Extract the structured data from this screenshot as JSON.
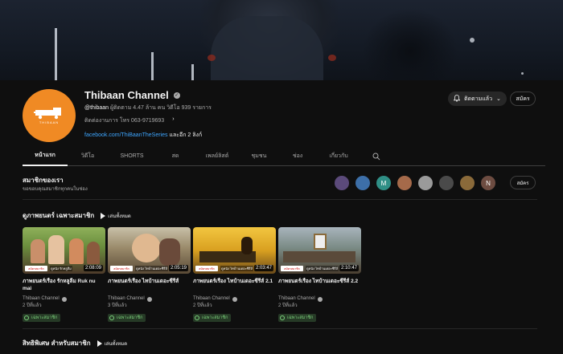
{
  "channel": {
    "name": "Thibaan Channel",
    "handle": "@thibaan",
    "subscribers": "ผู้ติดตาม 4.47 ล้าน คน",
    "videos": "วิดีโอ 939 รายการ",
    "contact": "ติดต่องานการ โทร 063-9719693",
    "link": "facebook.com/ThiBaanTheSeries",
    "link_more": "และอีก 2 ลิงก์",
    "avatar_text": "THIBAAN",
    "accent": "#f08a24"
  },
  "actions": {
    "subscribed_label": "ติดตามแล้ว",
    "join_label": "สมัคร"
  },
  "tabs": [
    {
      "label": "หน้าแรก",
      "active": true
    },
    {
      "label": "วิดีโอ"
    },
    {
      "label": "SHORTS"
    },
    {
      "label": "สด"
    },
    {
      "label": "เพลย์ลิสต์"
    },
    {
      "label": "ชุมชน"
    },
    {
      "label": "ช่อง"
    },
    {
      "label": "เกี่ยวกับ"
    }
  ],
  "members": {
    "title": "สมาชิกของเรา",
    "subtitle": "ขอขอบคุณสมาชิกทุกคนในช่อง",
    "avatars": [
      {
        "letter": "",
        "color": "#5b4a7a"
      },
      {
        "letter": "",
        "color": "#3d6fa8"
      },
      {
        "letter": "M",
        "color": "#2f8f86"
      },
      {
        "letter": "",
        "color": "#a56a4a"
      },
      {
        "letter": "",
        "color": "#9a9a9a"
      },
      {
        "letter": "",
        "color": "#4a4a4a"
      },
      {
        "letter": "",
        "color": "#8a6a3a"
      },
      {
        "letter": "N",
        "color": "#6d4c41"
      }
    ],
    "join_label": "สมัคร"
  },
  "section1": {
    "title": "ดูภาพยนตร์ เฉพาะสมาชิก",
    "play_all": "เล่นทั้งหมด"
  },
  "videos": [
    {
      "title": "ภาพยนตร์เรื่อง รักหลูลีม Ruk nu mai",
      "channel": "Thibaan Channel",
      "age": "2 ปีที่แล้ว",
      "duration": "2:08:09",
      "member_tag": "เฉพาะสมาชิก",
      "badge": "สมัครสมาชิก",
      "thumb_caption": "ดูหนัง รักหลูลีม"
    },
    {
      "title": "ภาพยนตร์เรื่อง ไทบ้านเดอะซีรีส์",
      "channel": "Thibaan Channel",
      "age": "3 ปีที่แล้ว",
      "duration": "2:05:19",
      "member_tag": "เฉพาะสมาชิก",
      "badge": "สมัครสมาชิก",
      "thumb_caption": "ดูหนัง ไทบ้านเดอะซีรีส์"
    },
    {
      "title": "ภาพยนตร์เรื่อง ไทบ้านเดอะซีรีส์ 2.1",
      "channel": "Thibaan Channel",
      "age": "2 ปีที่แล้ว",
      "duration": "2:03:47",
      "member_tag": "เฉพาะสมาชิก",
      "badge": "สมัครสมาชิก",
      "thumb_caption": "ดูหนัง ไทบ้านเดอะซีรีส์"
    },
    {
      "title": "ภาพยนตร์เรื่อง ไทบ้านเดอะซีรีส์ 2.2",
      "channel": "Thibaan Channel",
      "age": "2 ปีที่แล้ว",
      "duration": "2:10:47",
      "member_tag": "เฉพาะสมาชิก",
      "badge": "สมัครสมาชิก",
      "thumb_caption": "ดูหนัง ไทบ้านเดอะซีรีส์"
    }
  ],
  "section2": {
    "title": "สิทธิพิเศษ สำหรับสมาชิก",
    "play_all": "เล่นทั้งหมด"
  }
}
